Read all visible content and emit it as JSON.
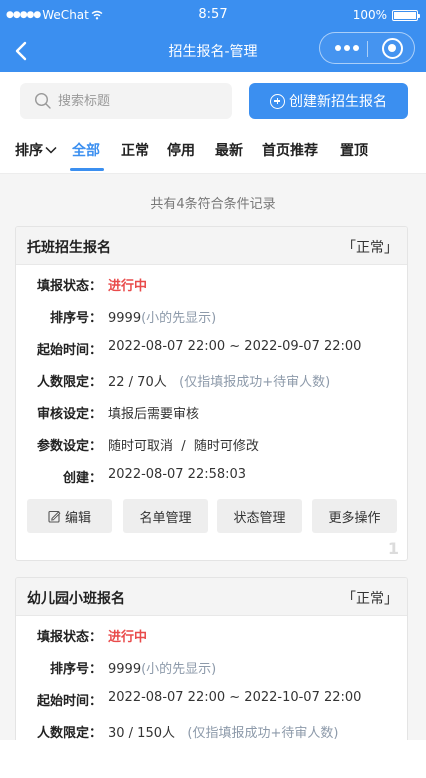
{
  "status_bar": {
    "carrier": "WeChat",
    "time": "8:57",
    "battery": "100%",
    "battery_level": 1.0
  },
  "nav": {
    "title": "招生报名-管理"
  },
  "search": {
    "placeholder": "搜索标题",
    "create_label": "创建新招生报名"
  },
  "tabs": {
    "sort_label": "排序",
    "items": [
      "全部",
      "正常",
      "停用",
      "最新",
      "首页推荐",
      "置顶"
    ],
    "active": "全部"
  },
  "summary": {
    "count_text": "共有4条符合条件记录"
  },
  "cards": [
    {
      "title": "托班招生报名",
      "status": "「正常」",
      "fill_status_label": "填报状态：",
      "fill_status_value": "进行中",
      "order_label": "排序号：",
      "order_value": "9999",
      "order_note": "(小的先显示)",
      "time_label": "起始时间：",
      "time_value": "2022-08-07 22:00 ~ 2022-09-07 22:00",
      "limit_label": "人数限定：",
      "limit_value": "22 / 70人",
      "limit_note": "(仅指填报成功+待审人数)",
      "review_label": "审核设定：",
      "review_value": "填报后需要审核",
      "param_label": "参数设定：",
      "param_value": "随时可取消  /  随时可修改",
      "created_label": "创建：",
      "created_value": "2022-08-07 22:58:03",
      "actions": [
        "编辑",
        "名单管理",
        "状态管理",
        "更多操作"
      ],
      "index": "1"
    },
    {
      "title": "幼儿园小班报名",
      "status": "「正常」",
      "fill_status_label": "填报状态：",
      "fill_status_value": "进行中",
      "order_label": "排序号：",
      "order_value": "9999",
      "order_note": "(小的先显示)",
      "time_label": "起始时间：",
      "time_value": "2022-08-07 22:00 ~ 2022-10-07 22:00",
      "limit_label": "人数限定：",
      "limit_value": "30 / 150人",
      "limit_note": "(仅指填报成功+待审人数)"
    }
  ],
  "colors": {
    "primary": "#3b8ff0",
    "active_status": "#e94b4b",
    "note": "#8d9aaa",
    "background": "#f5f5f5"
  },
  "icons": {
    "back": "chevron-left-icon",
    "more": "more-dots-icon",
    "close": "capsule-close-icon",
    "search": "search-icon",
    "create": "plus-circle-icon",
    "sort": "chevron-down-icon",
    "edit": "edit-icon"
  }
}
